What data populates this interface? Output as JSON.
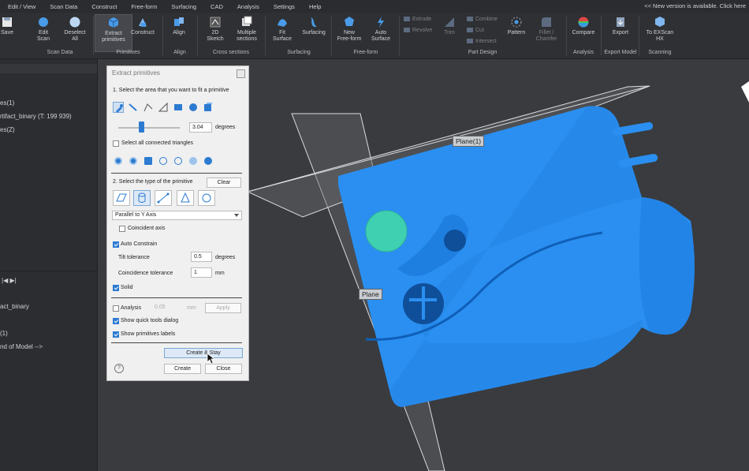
{
  "menubar": {
    "items": [
      "Edit / View",
      "Scan Data",
      "Construct",
      "Free-form",
      "Surfacing",
      "CAD",
      "Analysis",
      "Settings",
      "Help"
    ],
    "notice": "<< New version is available. Click here"
  },
  "ribbon": {
    "buttons": {
      "save": "Save",
      "edit_scan": "Edit\nScan",
      "deselect_all": "Deselect\nAll",
      "extract_primitives": "Extract\nprimitives",
      "construct": "Construct",
      "align": "Align",
      "sketch2d": "2D\nSketch",
      "multiple_sections": "Multiple\nsections",
      "fit_surface": "Fit\nSurface",
      "surfacing": "Surfacing",
      "new_freeform": "New\nFree-form",
      "auto_surface": "Auto\nSurface",
      "trim": "Trim",
      "pattern": "Pattern",
      "fillet_chamfer": "Fillet /\nChamfer",
      "compare": "Compare",
      "export": "Export",
      "to_exscan": "To EXScan\nHX"
    },
    "small": {
      "extrude": "Extrude",
      "revolve": "Revolve",
      "combine": "Combine",
      "cut": "Cut",
      "intersect": "Intersect"
    },
    "groups": [
      "Scan Data",
      "Primitives",
      "Align",
      "Cross sections",
      "Surfacing",
      "Free-form",
      "Part Design",
      "Analysis",
      "Export Model",
      "Scanning"
    ]
  },
  "left_panel": {
    "items": [
      "es(1)",
      "rtifact_binary (T: 199 939)",
      "es(Z)"
    ],
    "bottom_items": [
      "act_binary",
      "(1)",
      "nd of Model -->"
    ]
  },
  "viewport": {
    "labels": {
      "plane1": "Plane(1)",
      "plane": "Plane"
    }
  },
  "dialog": {
    "title": "Extract primitives",
    "step1": "1. Select the area that you want to fit a primitive",
    "degrees_value": "3.04",
    "degrees_unit": "degrees",
    "select_all_connected": "Select all connected triangles",
    "step2": "2. Select the type of the primitive",
    "clear": "Clear",
    "axis_option": "Parallel to Y Axis",
    "coincident_axis": "Coincident axis",
    "auto_constrain": "Auto Constrain",
    "tilt_tolerance_label": "Tilt tolerance",
    "tilt_tolerance_value": "0.5",
    "tilt_tolerance_unit": "degrees",
    "coincidence_tolerance_label": "Coincidence tolerance",
    "coincidence_tolerance_value": "1",
    "coincidence_tolerance_unit": "mm",
    "solid": "Solid",
    "analysis": "Analysis",
    "analysis_value": "0.05",
    "analysis_unit": "mm",
    "apply": "Apply",
    "show_quick_tools": "Show quick tools dialog",
    "show_primitive_labels": "Show primitives labels",
    "create_and_stay": "Create & Stay",
    "create": "Create",
    "close": "Close",
    "help": "?"
  },
  "colors": {
    "model": "#2a8ff0",
    "model_shadow": "#1c6fc4",
    "teal_disc": "#3fd0b2",
    "viewport_bg": "#3a3b3e",
    "accent": "#2d7bd1"
  }
}
